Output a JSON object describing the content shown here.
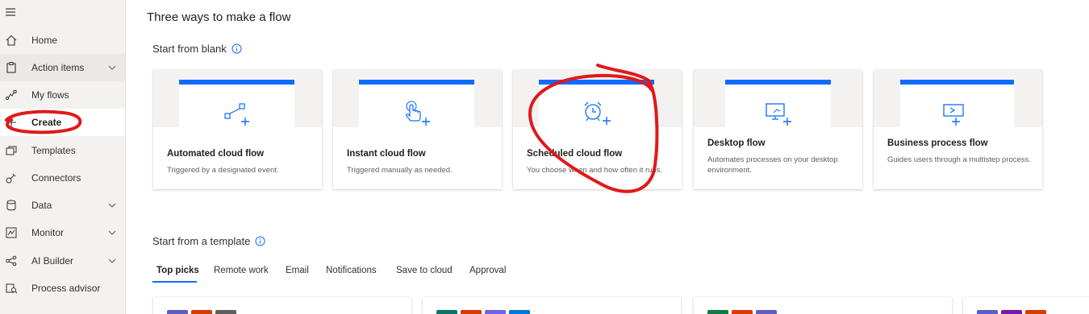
{
  "sidebar": {
    "menu_icon": "hamburger-icon",
    "items": [
      {
        "label": "Home",
        "icon": "home-icon"
      },
      {
        "label": "Action items",
        "icon": "clipboard-icon",
        "expandable": true
      },
      {
        "label": "My flows",
        "icon": "flow-icon"
      },
      {
        "label": "Create",
        "icon": "plus-icon",
        "active": true
      },
      {
        "label": "Templates",
        "icon": "templates-icon"
      },
      {
        "label": "Connectors",
        "icon": "connector-icon"
      },
      {
        "label": "Data",
        "icon": "database-icon",
        "expandable": true
      },
      {
        "label": "Monitor",
        "icon": "monitor-icon",
        "expandable": true
      },
      {
        "label": "AI Builder",
        "icon": "ai-builder-icon",
        "expandable": true
      },
      {
        "label": "Process advisor",
        "icon": "process-advisor-icon"
      }
    ]
  },
  "main": {
    "title": "Three ways to make a flow",
    "blank_section": "Start from blank",
    "template_section": "Start from a template",
    "cards": [
      {
        "title": "Automated cloud flow",
        "description": "Triggered by a designated event.",
        "icon": "automated-flow-icon"
      },
      {
        "title": "Instant cloud flow",
        "description": "Triggered manually as needed.",
        "icon": "touch-icon"
      },
      {
        "title": "Scheduled cloud flow",
        "description": "You choose when and how often it runs.",
        "icon": "alarm-clock-icon"
      },
      {
        "title": "Desktop flow",
        "description": "Automates processes on your desktop environment.",
        "icon": "desktop-icon"
      },
      {
        "title": "Business process flow",
        "description": "Guides users through a multistep process.",
        "icon": "business-process-icon"
      }
    ],
    "template_tabs": [
      "Top picks",
      "Remote work",
      "Email",
      "Notifications",
      "Save to cloud",
      "Approval"
    ],
    "active_tab": "Top picks"
  },
  "colors": {
    "accent": "#0f6cff",
    "annotation": "#e0191b",
    "sidebar_bg": "#f3f2f1"
  }
}
